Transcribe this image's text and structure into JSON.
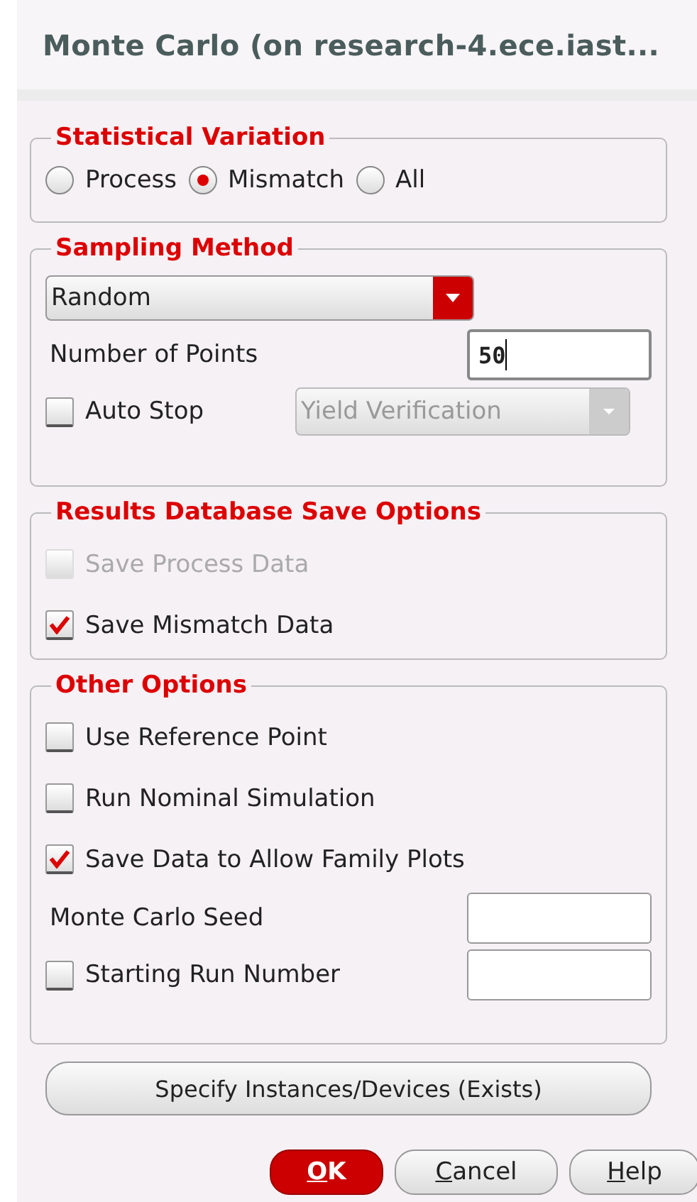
{
  "window": {
    "title": "Monte Carlo (on research-4.ece.iast..."
  },
  "groups": [
    {
      "title": "Statistical Variation",
      "rows": [
        {
          "kind": "radios",
          "options": [
            {
              "label": "Process",
              "selected": false
            },
            {
              "label": "Mismatch",
              "selected": true
            },
            {
              "label": "All",
              "selected": false
            }
          ]
        }
      ]
    },
    {
      "title": "Sampling Method",
      "rows": [
        {
          "kind": "dropdown",
          "value": "Random"
        },
        {
          "kind": "field",
          "label": "Number of Points",
          "value": "50",
          "focused": true
        },
        {
          "kind": "check_combo",
          "label": "Auto Stop",
          "checked": false,
          "value": "Yield Verification",
          "disabled": true
        }
      ]
    },
    {
      "title": "Results Database Save Options",
      "rows": [
        {
          "kind": "check",
          "label": "Save Process Data",
          "checked": false,
          "disabled": true
        },
        {
          "kind": "check",
          "label": "Save Mismatch Data",
          "checked": true,
          "disabled": false
        }
      ]
    },
    {
      "title": "Other Options",
      "rows": [
        {
          "kind": "check",
          "label": "Use Reference Point",
          "checked": false,
          "disabled": false
        },
        {
          "kind": "check",
          "label": "Run Nominal Simulation",
          "checked": false,
          "disabled": false
        },
        {
          "kind": "check",
          "label": "Save Data to Allow Family Plots",
          "checked": true,
          "disabled": false
        },
        {
          "kind": "field",
          "label": "Monte Carlo Seed",
          "value": "",
          "focused": false
        },
        {
          "kind": "check_field",
          "label": "Starting Run Number",
          "checked": false,
          "value": ""
        }
      ]
    }
  ],
  "specify_button": "Specify Instances/Devices (Exists)",
  "buttons": [
    {
      "label": "OK",
      "mnemonic_underlined": true,
      "default": true
    },
    {
      "label": "Cancel",
      "mnemonic_underlined": true,
      "default": false
    },
    {
      "label": "Help",
      "mnemonic_underlined": true,
      "default": false
    }
  ]
}
